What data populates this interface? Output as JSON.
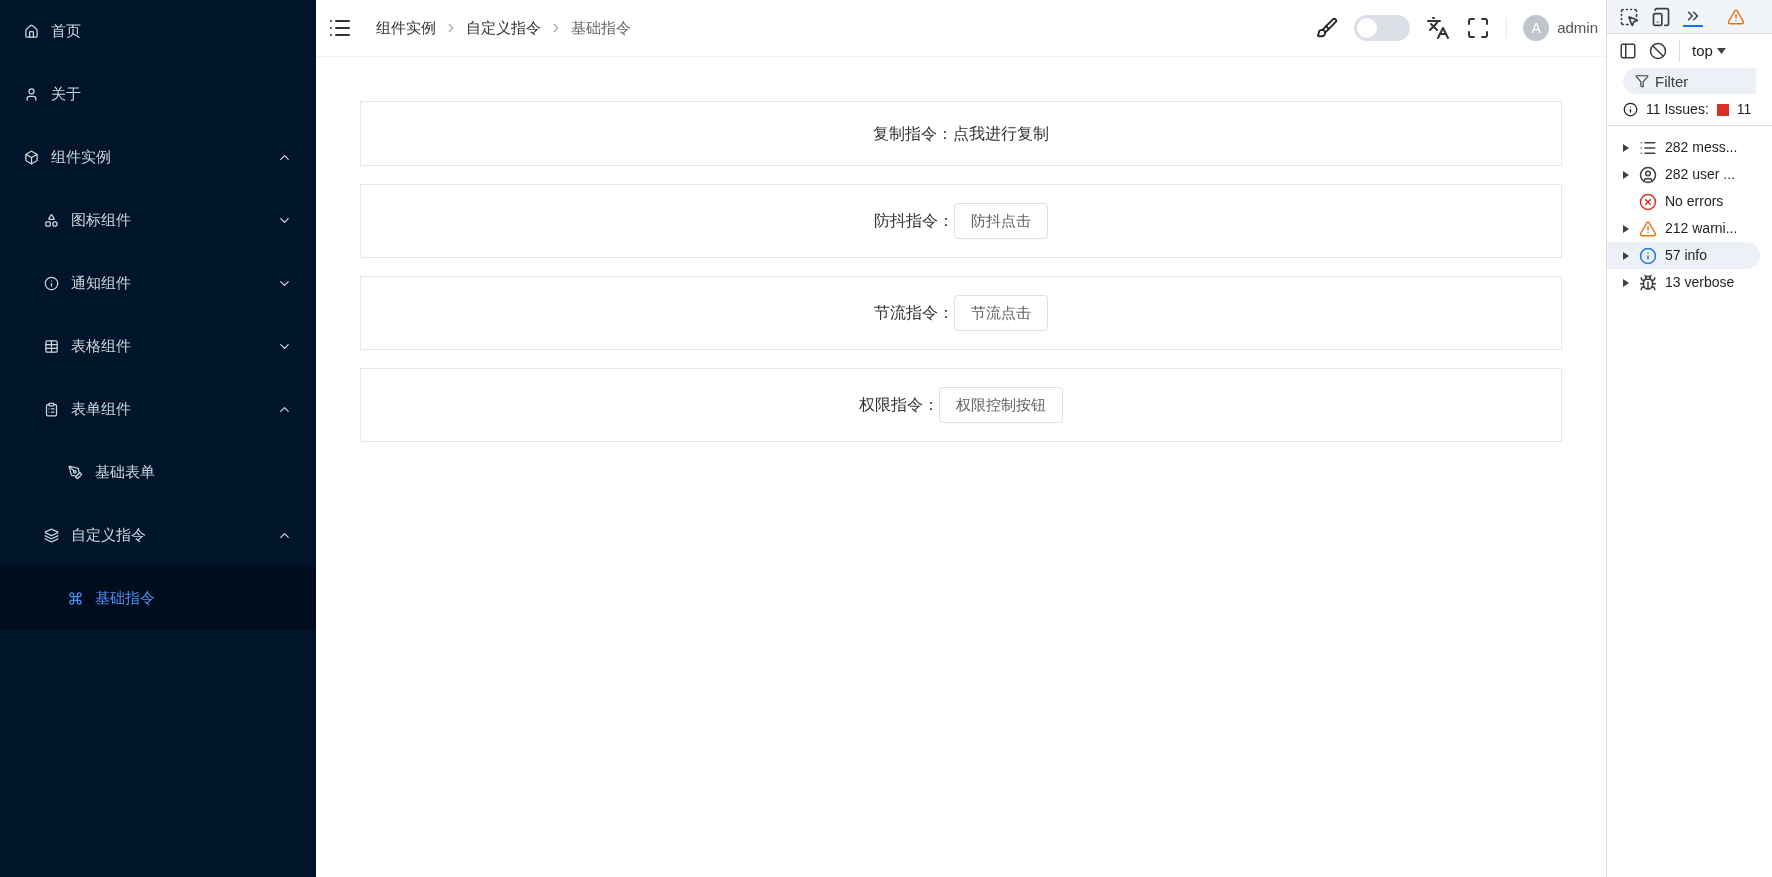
{
  "sidebar": {
    "items": [
      {
        "label": "首页",
        "selected": false
      },
      {
        "label": "关于",
        "selected": false
      },
      {
        "label": "组件实例",
        "selected": false,
        "expanded": true,
        "children": [
          {
            "label": "图标组件",
            "selected": false,
            "expanded": false
          },
          {
            "label": "通知组件",
            "selected": false,
            "expanded": false
          },
          {
            "label": "表格组件",
            "selected": false,
            "expanded": false
          },
          {
            "label": "表单组件",
            "selected": false,
            "expanded": true,
            "children": [
              {
                "label": "基础表单",
                "selected": false
              }
            ]
          },
          {
            "label": "自定义指令",
            "selected": false,
            "expanded": true,
            "children": [
              {
                "label": "基础指令",
                "selected": true
              }
            ]
          }
        ]
      }
    ]
  },
  "header": {
    "breadcrumb": [
      "组件实例",
      "自定义指令",
      "基础指令"
    ],
    "theme_switch": {
      "on": false
    },
    "avatar": "A",
    "user": "admin"
  },
  "cards": [
    {
      "label": "复制指令：",
      "text": "点我进行复制",
      "kind": "text"
    },
    {
      "label": "防抖指令：",
      "text": "防抖点击",
      "kind": "button"
    },
    {
      "label": "节流指令：",
      "text": "节流点击",
      "kind": "button"
    },
    {
      "label": "权限指令：",
      "text": "权限控制按钮",
      "kind": "button"
    }
  ],
  "devtools": {
    "context": "top",
    "filter": {
      "placeholder": "Filter"
    },
    "issues": {
      "label": "11 Issues:",
      "count": "11"
    },
    "rows": [
      {
        "kind": "messages",
        "text": "282 mess...",
        "expandable": true,
        "selected": false
      },
      {
        "kind": "user",
        "text": "282 user ...",
        "expandable": true,
        "selected": false
      },
      {
        "kind": "errors",
        "text": "No errors",
        "expandable": false,
        "selected": false
      },
      {
        "kind": "warnings",
        "text": "212 warni...",
        "expandable": true,
        "selected": false
      },
      {
        "kind": "info",
        "text": "57 info",
        "expandable": true,
        "selected": true
      },
      {
        "kind": "verbose",
        "text": "13 verbose",
        "expandable": true,
        "selected": false
      }
    ]
  }
}
